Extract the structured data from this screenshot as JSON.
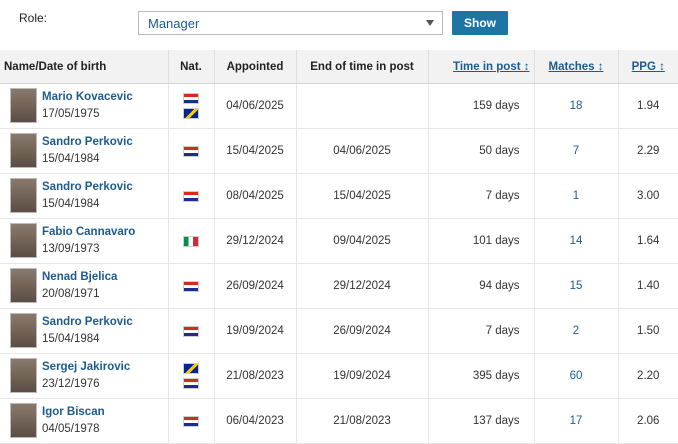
{
  "filter": {
    "role_label": "Role:",
    "selected_role": "Manager",
    "show_label": "Show"
  },
  "table": {
    "headers": {
      "name": "Name/Date of birth",
      "nat": "Nat.",
      "appointed": "Appointed",
      "end": "End of time in post",
      "time": "Time in post ↕",
      "matches": "Matches ↕",
      "ppg": "PPG ↕"
    },
    "rows": [
      {
        "name": "Mario Kovacevic",
        "dob": "17/05/1975",
        "flags": [
          "cro",
          "bih"
        ],
        "appointed": "04/06/2025",
        "end": "",
        "time": "159 days",
        "matches": "18",
        "ppg": "1.94"
      },
      {
        "name": "Sandro Perkovic",
        "dob": "15/04/1984",
        "flags": [
          "cro"
        ],
        "appointed": "15/04/2025",
        "end": "04/06/2025",
        "time": "50 days",
        "matches": "7",
        "ppg": "2.29"
      },
      {
        "name": "Sandro Perkovic",
        "dob": "15/04/1984",
        "flags": [
          "cro"
        ],
        "appointed": "08/04/2025",
        "end": "15/04/2025",
        "time": "7 days",
        "matches": "1",
        "ppg": "3.00"
      },
      {
        "name": "Fabio Cannavaro",
        "dob": "13/09/1973",
        "flags": [
          "ita"
        ],
        "appointed": "29/12/2024",
        "end": "09/04/2025",
        "time": "101 days",
        "matches": "14",
        "ppg": "1.64"
      },
      {
        "name": "Nenad Bjelica",
        "dob": "20/08/1971",
        "flags": [
          "cro"
        ],
        "appointed": "26/09/2024",
        "end": "29/12/2024",
        "time": "94 days",
        "matches": "15",
        "ppg": "1.40"
      },
      {
        "name": "Sandro Perkovic",
        "dob": "15/04/1984",
        "flags": [
          "cro"
        ],
        "appointed": "19/09/2024",
        "end": "26/09/2024",
        "time": "7 days",
        "matches": "2",
        "ppg": "1.50"
      },
      {
        "name": "Sergej Jakirovic",
        "dob": "23/12/1976",
        "flags": [
          "bih",
          "cro"
        ],
        "appointed": "21/08/2023",
        "end": "19/09/2024",
        "time": "395 days",
        "matches": "60",
        "ppg": "2.20"
      },
      {
        "name": "Igor Biscan",
        "dob": "04/05/1978",
        "flags": [
          "cro"
        ],
        "appointed": "06/04/2023",
        "end": "21/08/2023",
        "time": "137 days",
        "matches": "17",
        "ppg": "2.06"
      }
    ]
  }
}
